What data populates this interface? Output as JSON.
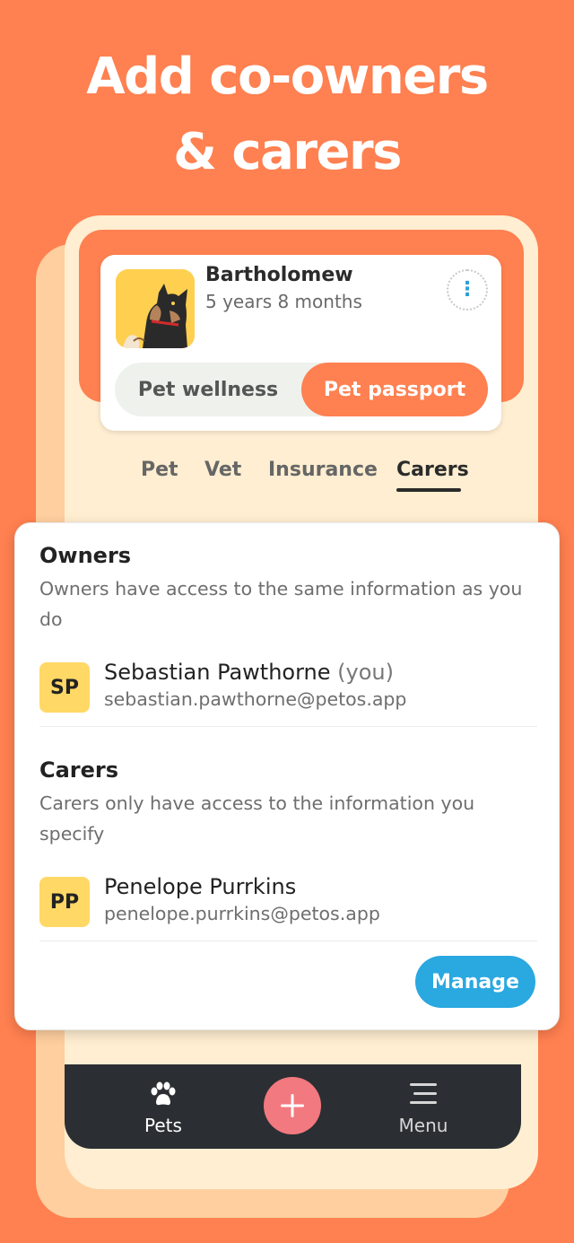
{
  "headline": {
    "line1": "Add co-owners",
    "line2": "& carers"
  },
  "pet": {
    "name": "Bartholomew",
    "age": "5 years 8 months",
    "avatar_icon": "dog-portrait-icon",
    "more_icon": "more-vertical-icon"
  },
  "segment": {
    "left_label": "Pet wellness",
    "right_label": "Pet passport",
    "selected": "Pet passport"
  },
  "tabs": [
    {
      "label": "Pet"
    },
    {
      "label": "Vet"
    },
    {
      "label": "Insurance"
    },
    {
      "label": "Carers",
      "active": true
    }
  ],
  "owners": {
    "title": "Owners",
    "description": "Owners have access to the same information as you do",
    "people": [
      {
        "initials": "SP",
        "name": "Sebastian Pawthorne",
        "suffix": "(you)",
        "email": "sebastian.pawthorne@petos.app"
      }
    ]
  },
  "carers": {
    "title": "Carers",
    "description": "Carers only have access to the information you specify",
    "people": [
      {
        "initials": "PP",
        "name": "Penelope Purrkins",
        "email": "penelope.purrkins@petos.app"
      }
    ]
  },
  "manage_label": "Manage",
  "nav": {
    "pets_label": "Pets",
    "menu_label": "Menu",
    "pets_icon": "paw-icon",
    "add_icon": "plus-icon",
    "menu_icon": "menu-icon"
  },
  "colors": {
    "background": "#ff8050",
    "accent_orange": "#ff8050",
    "accent_blue": "#2aa8e0",
    "badge_yellow": "#ffd866",
    "nav_dark": "#2b2f33",
    "add_pink": "#f2797f"
  }
}
